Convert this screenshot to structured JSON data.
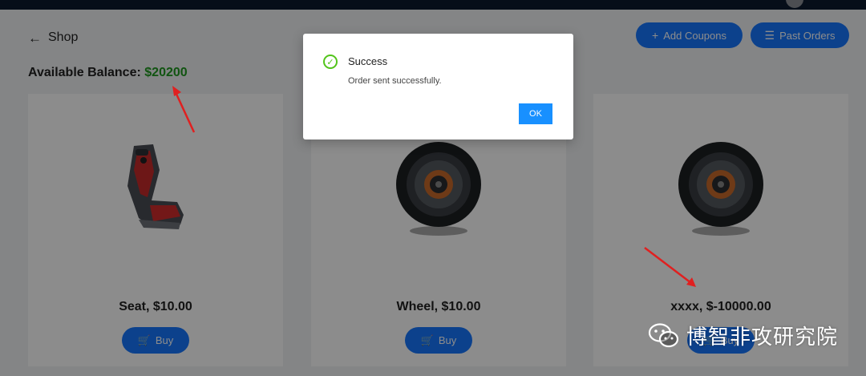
{
  "header": {
    "back_icon": "arrow-left-icon",
    "title": "Shop"
  },
  "actions": {
    "add_coupons_label": "Add Coupons",
    "add_coupons_icon": "plus-icon",
    "past_orders_label": "Past Orders",
    "past_orders_icon": "list-icon"
  },
  "balance": {
    "label": "Available Balance:",
    "amount": "$20200"
  },
  "products": [
    {
      "name": "Seat, $10.00",
      "buy_label": "Buy",
      "image": "car-seat"
    },
    {
      "name": "Wheel, $10.00",
      "buy_label": "Buy",
      "image": "wheel"
    },
    {
      "name": "xxxx, $-10000.00",
      "buy_label": "Buy",
      "image": "wheel"
    }
  ],
  "modal": {
    "title": "Success",
    "content": "Order sent successfully.",
    "ok_label": "OK",
    "icon": "check-circle-icon"
  },
  "watermark": {
    "text": "博智非攻研究院",
    "icon": "wechat-icon"
  },
  "colors": {
    "primary": "#1677ff",
    "balance_green": "#1f9a1f",
    "success_green": "#52c41a",
    "annotation_red": "#e02020",
    "topbar": "#0b1a2e"
  }
}
